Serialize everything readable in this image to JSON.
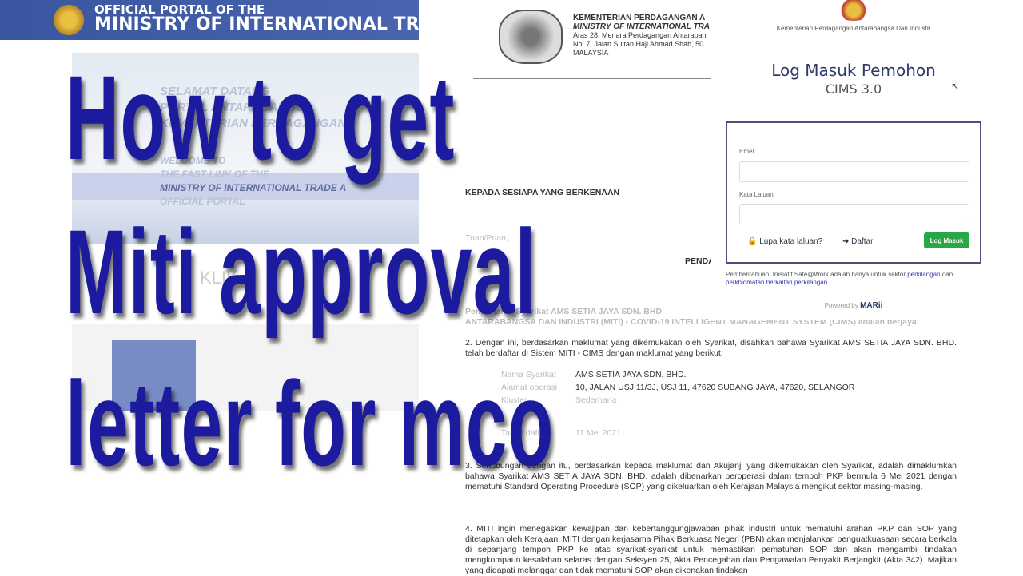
{
  "portal": {
    "header_line1": "OFFICIAL PORTAL OF THE",
    "header_line2": "MINISTRY OF INTERNATIONAL TRADE",
    "banner_lines": [
      "SELAMAT DATANG",
      "PORTAL ANTARABANGSA",
      "KEMENTERIAN PERDAGANGAN",
      "WELCOME TO",
      "THE FAST LINK OF THE",
      "MINISTRY OF INTERNATIONAL TRADE A",
      "OFFICIAL PORTAL"
    ],
    "link_text": "KLIK"
  },
  "letter": {
    "head": [
      "KEMENTERIAN PERDAGANGAN A",
      "MINISTRY OF INTERNATIONAL TRA",
      "Aras 28, Menara Perdagangan Antaraban",
      "No. 7, Jalan Sultan Haji Ahmad Shah, 50",
      "MALAYSIA"
    ],
    "salutation": "KEPADA SESIAPA YANG BERKENAAN",
    "tuan": "Tuan/Puan,",
    "subject": "PENDAFTARAN SYARIKAT DI DALAM SISTEM",
    "p1a": "Pendaftaran Syarikat AMS SETIA JAYA SDN. BHD",
    "p1b": "ANTARABANGSA DAN INDUSTRI (MITI) - COVID-19 INTELLIGENT MANAGEMENT SYSTEM (CIMS) adalah berjaya.",
    "p2": "2.        Dengan ini, berdasarkan maklumat yang dikemukakan oleh Syarikat, disahkan bahawa Syarikat AMS SETIA JAYA SDN. BHD. telah berdaftar di Sistem MITI - CIMS dengan maklumat yang berikut:",
    "fields": [
      {
        "label": "Nama Syarikat",
        "value": "AMS SETIA JAYA SDN. BHD."
      },
      {
        "label": "Alamat operasi",
        "value": "10, JALAN USJ 11/3J, USJ 11, 47620 SUBANG JAYA, 47620, SELANGOR"
      },
      {
        "label": "Kluster",
        "value": "Sederhana"
      },
      {
        "label": "Tarikh daftar",
        "value": "11 Mei 2021"
      }
    ],
    "p3": "3.        Sehubungan dengan itu, berdasarkan kepada maklumat dan Akujanji yang dikemukakan oleh Syarikat, adalah dimaklumkan bahawa Syarikat AMS SETIA JAYA SDN. BHD. adalah dibenarkan beroperasi dalam tempoh PKP bermula 6 Mei 2021 dengan mematuhi Standard Operating Procedure (SOP) yang dikeluarkan oleh Kerajaan Malaysia mengikut sektor masing-masing.",
    "p4": "4.        MITI ingin menegaskan kewajipan dan kebertanggungjawaban pihak industri untuk mematuhi arahan PKP dan SOP yang ditetapkan oleh Kerajaan. MITI dengan kerjasama Pihak Berkuasa Negeri (PBN) akan menjalankan penguatkuasaan secara berkala di sepanjang tempoh PKP ke atas syarikat-syarikat untuk memastikan pematuhan SOP dan akan mengambil tindakan mengkompaun kesalahan selaras dengan Seksyen 25, Akta Pencegahan dan Pengawalan Penyakit Berjangkit (Akta 342). Majikan yang didapati melanggar dan tidak mematuhi SOP akan dikenakan tindakan"
  },
  "login": {
    "ministry": "Kementerian Perdagangan Antarabangsa Dan Industri",
    "title": "Log Masuk Pemohon",
    "subtitle": "CIMS 3.0",
    "email_label": "Emel",
    "email_value": "",
    "password_label": "Kata Laluan",
    "password_value": "",
    "forgot": "Lupa kata laluan?",
    "register": "Daftar",
    "submit": "Log Masuk",
    "notice_text": "Pemberitahuan: Inisiatif Safe@Work adalah hanya untuk sektor ",
    "notice_link1": "perkilangan",
    "notice_and": " dan ",
    "notice_link2": "perkhidmatan berkaitan perkilangan",
    "powered_by": "Powered by",
    "brand": "MARii",
    "accent": "#28a745"
  },
  "overlay": {
    "line1": "How to get",
    "line2": "Miti approval",
    "line3": "letter for mco",
    "color": "#1c1ba0"
  }
}
